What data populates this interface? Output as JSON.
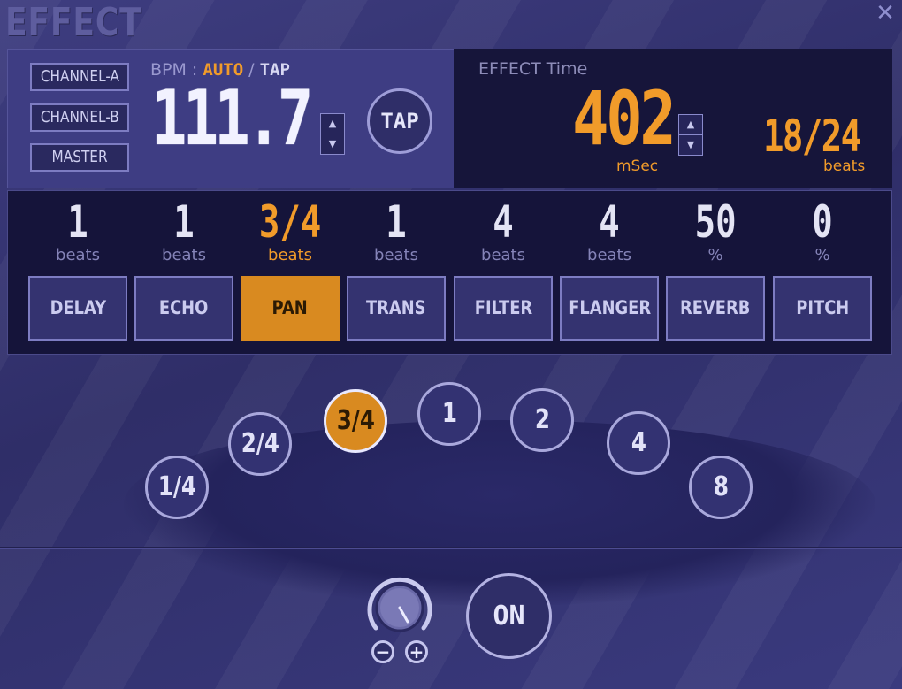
{
  "window": {
    "title": "EFFECT",
    "close_label": "✕"
  },
  "channels": [
    {
      "label": "CHANNEL-A",
      "active": true
    },
    {
      "label": "CHANNEL-B",
      "active": false
    },
    {
      "label": "MASTER",
      "active": false
    }
  ],
  "bpm": {
    "label": "BPM :",
    "auto_label": "AUTO",
    "separator": " / ",
    "tap_label": "TAP",
    "value": "111.7",
    "tap_button_label": "TAP",
    "up_label": "▲",
    "down_label": "▼"
  },
  "effect_time": {
    "label": "EFFECT Time",
    "value": "402",
    "unit": "mSec",
    "beats_value": "18/24",
    "beats_unit": "beats",
    "up_label": "▲",
    "down_label": "▼"
  },
  "effects": [
    {
      "value": "1",
      "unit": "beats",
      "label": "DELAY",
      "selected": false
    },
    {
      "value": "1",
      "unit": "beats",
      "label": "ECHO",
      "selected": false
    },
    {
      "value": "3/4",
      "unit": "beats",
      "label": "PAN",
      "selected": true
    },
    {
      "value": "1",
      "unit": "beats",
      "label": "TRANS",
      "selected": false
    },
    {
      "value": "4",
      "unit": "beats",
      "label": "FILTER",
      "selected": false
    },
    {
      "value": "4",
      "unit": "beats",
      "label": "FLANGER",
      "selected": false
    },
    {
      "value": "50",
      "unit": "%",
      "label": "REVERB",
      "selected": false
    },
    {
      "value": "0",
      "unit": "%",
      "label": "PITCH",
      "selected": false
    }
  ],
  "beat_selector": [
    {
      "label": "1/4",
      "active": false
    },
    {
      "label": "2/4",
      "active": false
    },
    {
      "label": "3/4",
      "active": true
    },
    {
      "label": "1",
      "active": false
    },
    {
      "label": "2",
      "active": false
    },
    {
      "label": "4",
      "active": false
    },
    {
      "label": "8",
      "active": false
    }
  ],
  "controls": {
    "minus_label": "−",
    "plus_label": "+",
    "on_label": "ON"
  },
  "colors": {
    "accent": "#f19b2a",
    "active_button": "#d98a20",
    "background": "#35347a"
  }
}
